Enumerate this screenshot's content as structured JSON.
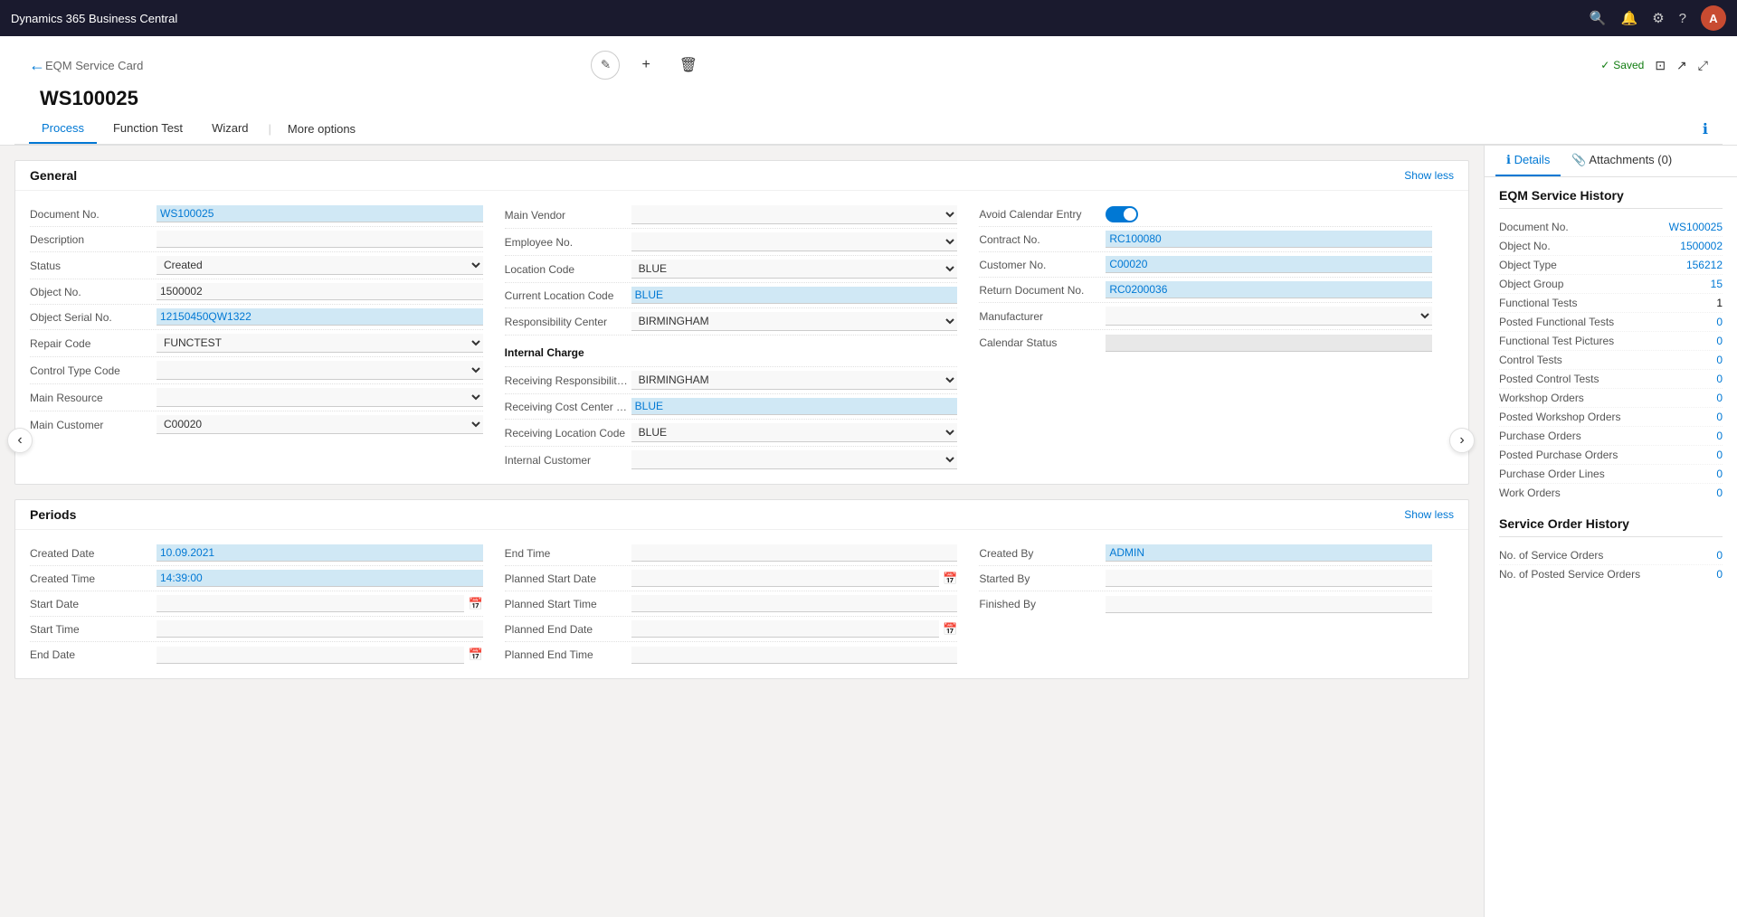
{
  "topnav": {
    "title": "Dynamics 365 Business Central",
    "icons": [
      "search",
      "bell",
      "settings",
      "help"
    ],
    "avatar": "A"
  },
  "breadcrumb": "EQM Service Card",
  "page_title": "WS100025",
  "header_actions": {
    "saved": "Saved",
    "edit_icon": "✎",
    "add_icon": "+",
    "delete_icon": "🗑"
  },
  "tabs": [
    {
      "label": "Process",
      "active": true
    },
    {
      "label": "Function Test",
      "active": false
    },
    {
      "label": "Wizard",
      "active": false
    },
    {
      "label": "More options",
      "active": false
    }
  ],
  "general_section": {
    "title": "General",
    "show_less": "Show less",
    "col1": {
      "fields": [
        {
          "label": "Document No.",
          "value": "WS100025",
          "type": "input",
          "highlighted": true
        },
        {
          "label": "Description",
          "value": "",
          "type": "input"
        },
        {
          "label": "Status",
          "value": "Created",
          "type": "select"
        },
        {
          "label": "Object No.",
          "value": "1500002",
          "type": "input"
        },
        {
          "label": "Object Serial No.",
          "value": "12150450QW1322",
          "type": "input",
          "highlighted": true
        },
        {
          "label": "Repair Code",
          "value": "FUNCTEST",
          "type": "select"
        },
        {
          "label": "Control Type Code",
          "value": "",
          "type": "select"
        },
        {
          "label": "Main Resource",
          "value": "",
          "type": "select"
        },
        {
          "label": "Main Customer",
          "value": "C00020",
          "type": "select"
        }
      ]
    },
    "col2": {
      "fields": [
        {
          "label": "Main Vendor",
          "value": "",
          "type": "select"
        },
        {
          "label": "Employee No.",
          "value": "",
          "type": "select"
        },
        {
          "label": "Location Code",
          "value": "BLUE",
          "type": "select"
        },
        {
          "label": "Current Location Code",
          "value": "BLUE",
          "type": "input",
          "highlighted": true
        },
        {
          "label": "Responsibility Center",
          "value": "BIRMINGHAM",
          "type": "select"
        },
        {
          "label": "subsection",
          "value": "Internal Charge",
          "type": "subsection"
        },
        {
          "label": "Receiving Responsibility Center",
          "value": "BIRMINGHAM",
          "type": "select"
        },
        {
          "label": "Receiving Cost Center Code",
          "value": "BLUE",
          "type": "input",
          "highlighted": true
        },
        {
          "label": "Receiving Location Code",
          "value": "BLUE",
          "type": "select"
        },
        {
          "label": "Internal Customer",
          "value": "",
          "type": "select"
        }
      ]
    },
    "col3": {
      "fields": [
        {
          "label": "Avoid Calendar Entry",
          "value": "",
          "type": "toggle"
        },
        {
          "label": "Contract No.",
          "value": "RC100080",
          "type": "input",
          "highlighted": true
        },
        {
          "label": "Customer No.",
          "value": "C00020",
          "type": "input",
          "highlighted": true
        },
        {
          "label": "Return Document No.",
          "value": "RC0200036",
          "type": "input",
          "highlighted": true
        },
        {
          "label": "Manufacturer",
          "value": "",
          "type": "select"
        },
        {
          "label": "Calendar Status",
          "value": "",
          "type": "input",
          "highlighted": false
        }
      ]
    }
  },
  "periods_section": {
    "title": "Periods",
    "show_less": "Show less",
    "col1": {
      "fields": [
        {
          "label": "Created Date",
          "value": "10.09.2021",
          "type": "input",
          "highlighted": true
        },
        {
          "label": "Created Time",
          "value": "14:39:00",
          "type": "input",
          "highlighted": true
        },
        {
          "label": "Start Date",
          "value": "",
          "type": "date"
        },
        {
          "label": "Start Time",
          "value": "",
          "type": "input"
        },
        {
          "label": "End Date",
          "value": "",
          "type": "date"
        }
      ]
    },
    "col2": {
      "fields": [
        {
          "label": "End Time",
          "value": "",
          "type": "input"
        },
        {
          "label": "Planned Start Date",
          "value": "",
          "type": "date"
        },
        {
          "label": "Planned Start Time",
          "value": "",
          "type": "input"
        },
        {
          "label": "Planned End Date",
          "value": "",
          "type": "date"
        },
        {
          "label": "Planned End Time",
          "value": "",
          "type": "input"
        }
      ]
    },
    "col3": {
      "fields": [
        {
          "label": "Created By",
          "value": "ADMIN",
          "type": "input",
          "highlighted": true
        },
        {
          "label": "Started By",
          "value": "",
          "type": "input"
        },
        {
          "label": "Finished By",
          "value": "",
          "type": "input"
        }
      ]
    }
  },
  "right_panel": {
    "tabs": [
      {
        "label": "Details",
        "icon": "ℹ",
        "active": true
      },
      {
        "label": "Attachments (0)",
        "icon": "📎",
        "active": false
      }
    ],
    "eqm_section": {
      "title": "EQM Service History",
      "rows": [
        {
          "label": "Document No.",
          "value": "WS100025",
          "type": "link"
        },
        {
          "label": "Object No.",
          "value": "1500002",
          "type": "link"
        },
        {
          "label": "Object Type",
          "value": "156212",
          "type": "link"
        },
        {
          "label": "Object Group",
          "value": "15",
          "type": "link"
        },
        {
          "label": "Functional Tests",
          "value": "1",
          "type": "dark"
        },
        {
          "label": "Posted Functional Tests",
          "value": "0",
          "type": "link"
        },
        {
          "label": "Functional Test Pictures",
          "value": "0",
          "type": "link"
        },
        {
          "label": "Control Tests",
          "value": "0",
          "type": "link"
        },
        {
          "label": "Posted Control Tests",
          "value": "0",
          "type": "link"
        },
        {
          "label": "Workshop Orders",
          "value": "0",
          "type": "link"
        },
        {
          "label": "Posted Workshop Orders",
          "value": "0",
          "type": "link"
        },
        {
          "label": "Purchase Orders",
          "value": "0",
          "type": "link"
        },
        {
          "label": "Posted Purchase Orders",
          "value": "0",
          "type": "link"
        },
        {
          "label": "Purchase Order Lines",
          "value": "0",
          "type": "link"
        },
        {
          "label": "Work Orders",
          "value": "0",
          "type": "link"
        }
      ]
    },
    "service_section": {
      "title": "Service Order History",
      "rows": [
        {
          "label": "No. of Service Orders",
          "value": "0",
          "type": "link"
        },
        {
          "label": "No. of Posted Service Orders",
          "value": "0",
          "type": "link"
        }
      ]
    }
  }
}
